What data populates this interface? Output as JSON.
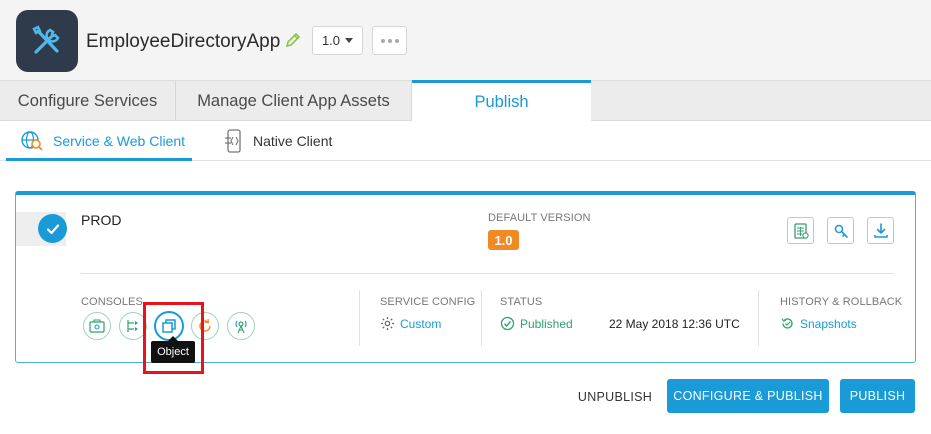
{
  "app": {
    "title": "EmployeeDirectoryApp",
    "version": "1.0"
  },
  "main_tabs": [
    {
      "label": "Configure Services"
    },
    {
      "label": "Manage Client App Assets"
    },
    {
      "label": "Publish"
    }
  ],
  "sub_tabs": [
    {
      "label": "Service & Web Client"
    },
    {
      "label": "Native Client"
    }
  ],
  "environment": {
    "name": "PROD",
    "default_version_label": "DEFAULT VERSION",
    "default_version": "1.0",
    "consoles_label": "CONSOLES",
    "service_config_label": "SERVICE CONFIG",
    "service_config_value": "Custom",
    "status_label": "STATUS",
    "status_value": "Published",
    "timestamp": "22 May 2018 12:36 UTC",
    "history_label": "HISTORY & ROLLBACK",
    "history_value": "Snapshots"
  },
  "tooltip": "Object",
  "buttons": {
    "unpublish": "UNPUBLISH",
    "configure_publish": "CONFIGURE & PUBLISH",
    "publish": "PUBLISH"
  },
  "colors": {
    "accent": "#1a9ad6",
    "badge": "#f08a24",
    "status_ok": "#2fa36b",
    "highlight": "#e8131b"
  }
}
